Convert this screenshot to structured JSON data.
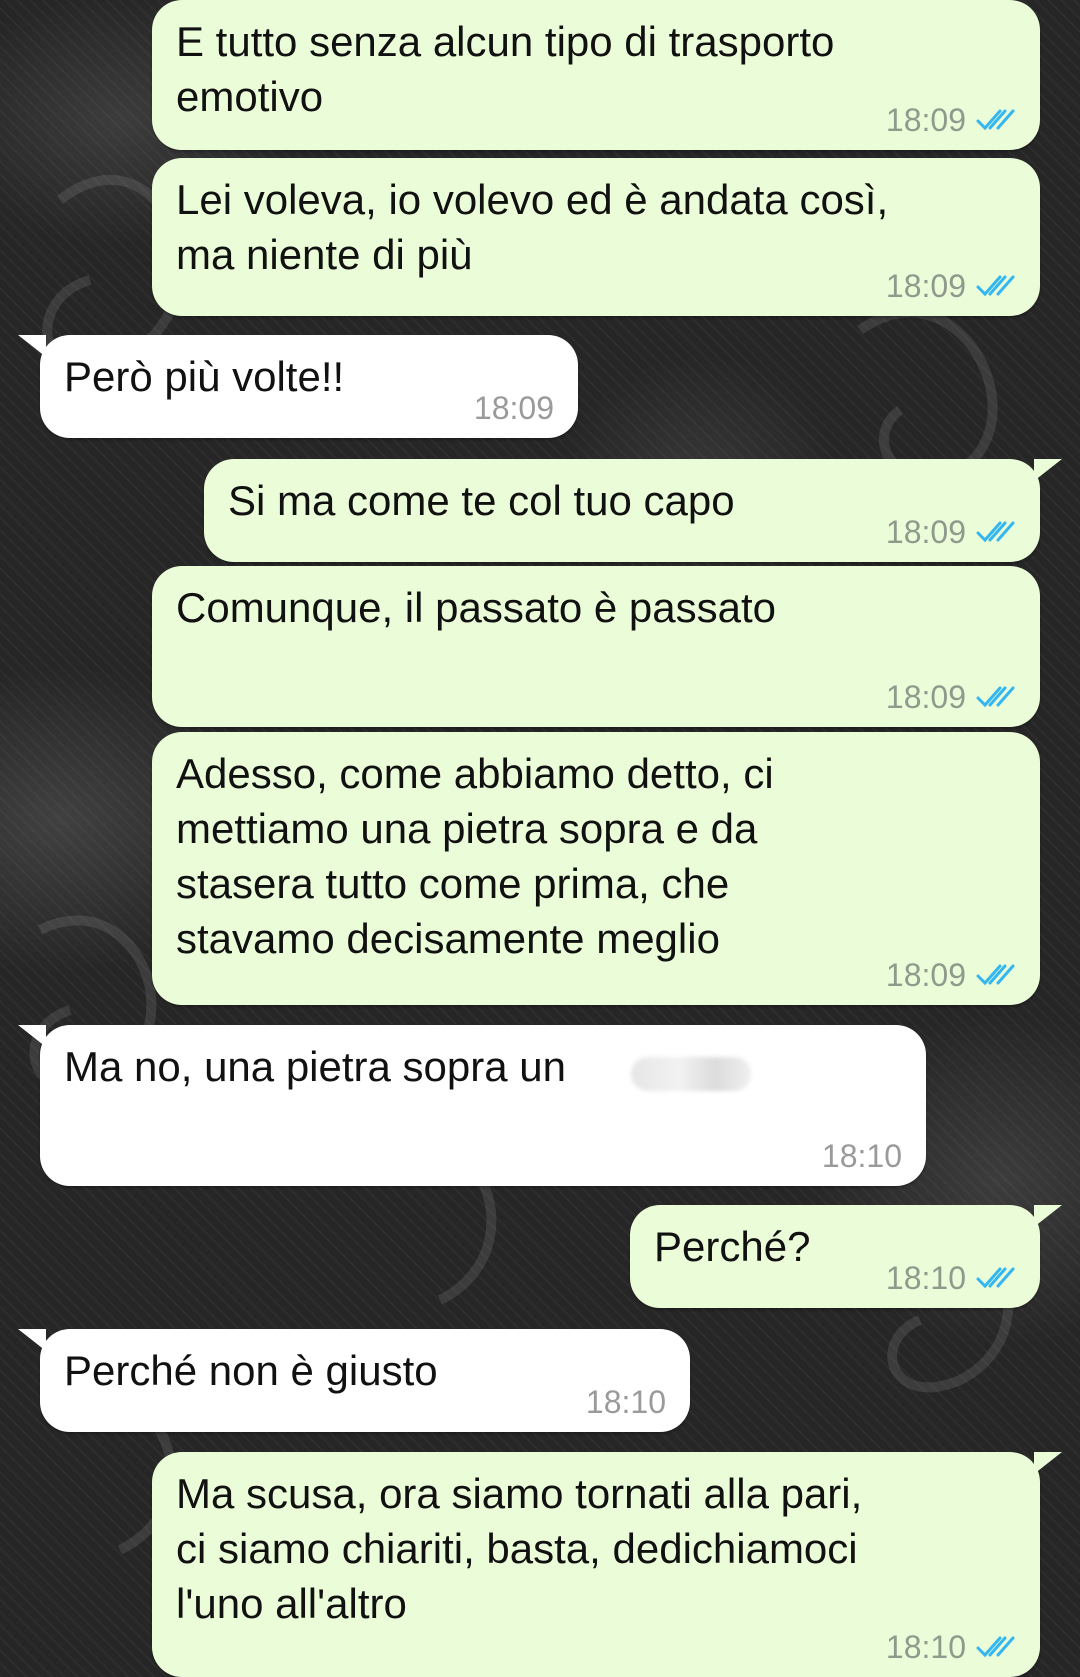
{
  "messages": [
    {
      "dir": "out",
      "text": "E tutto senza alcun tipo di trasporto\nemotivo",
      "time": "18:09",
      "read": true
    },
    {
      "dir": "out",
      "text": "Lei voleva, io volevo ed è andata così,\nma niente di più",
      "time": "18:09",
      "read": true
    },
    {
      "dir": "in",
      "text": "Però più volte!!",
      "time": "18:09"
    },
    {
      "dir": "out",
      "text": "Si ma come te col tuo capo",
      "time": "18:09",
      "read": true
    },
    {
      "dir": "out",
      "text": "Comunque, il passato è passato",
      "time": "18:09",
      "read": true
    },
    {
      "dir": "out",
      "text": "Adesso, come abbiamo detto, ci\nmettiamo una pietra sopra e da\nstasera tutto come prima, che\nstavamo decisamente meglio",
      "time": "18:09",
      "read": true
    },
    {
      "dir": "in",
      "text": "Ma no, una pietra sopra un",
      "time": "18:10",
      "redacted": true
    },
    {
      "dir": "out",
      "text": "Perché?",
      "time": "18:10",
      "read": true
    },
    {
      "dir": "in",
      "text": "Perché non è giusto",
      "time": "18:10"
    },
    {
      "dir": "out",
      "text": "Ma scusa, ora siamo tornati alla pari,\nci siamo chiariti, basta, dedichiamoci\nl'uno all'altro",
      "time": "18:10",
      "read": true
    }
  ],
  "colors": {
    "outgoing_bubble": "#ebfcd9",
    "incoming_bubble": "#ffffff",
    "read_ticks": "#34b7f1",
    "wallpaper": "#262626"
  },
  "icons": {
    "read_receipt": "double-check-icon"
  }
}
